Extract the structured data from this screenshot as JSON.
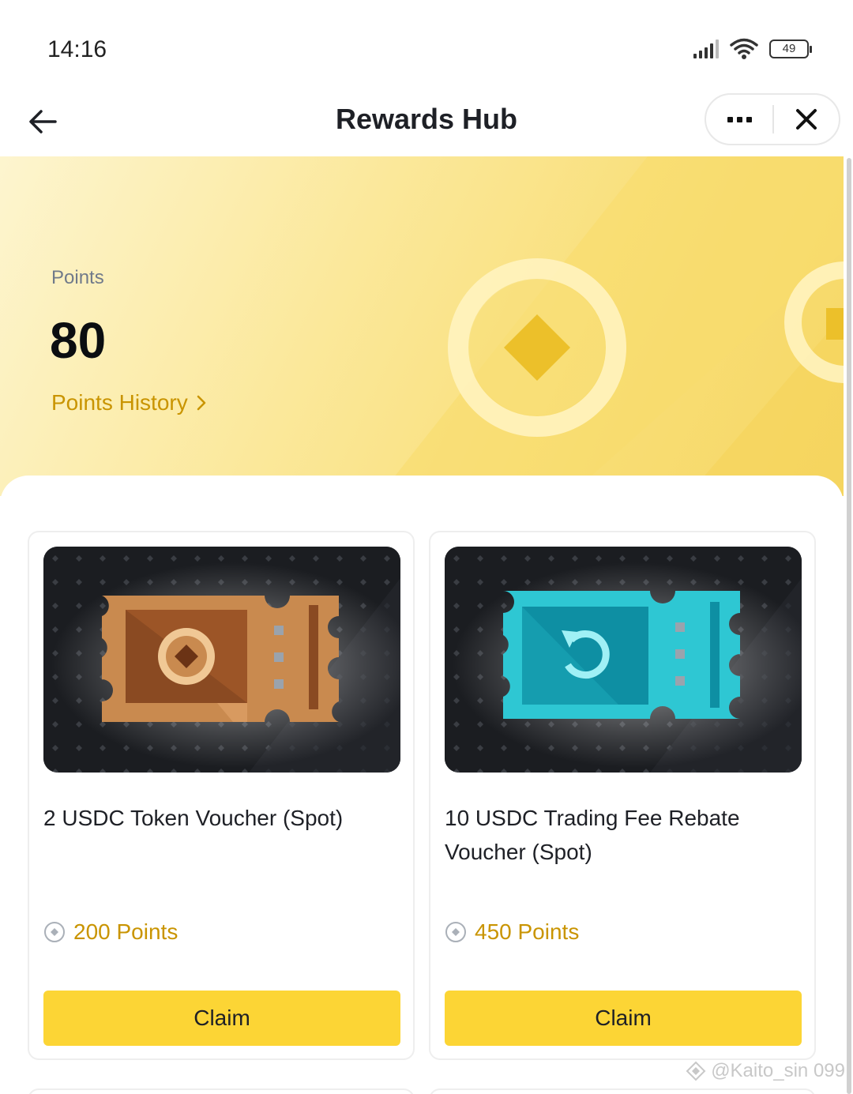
{
  "status_bar": {
    "time": "14:16",
    "battery": "49",
    "icons": [
      "signal-icon",
      "wifi-icon",
      "battery-icon"
    ]
  },
  "header": {
    "title": "Rewards Hub",
    "back_icon": "arrow-left-icon",
    "more_icon": "more-dots-icon",
    "close_icon": "close-icon"
  },
  "banner": {
    "points_label": "Points",
    "points_value": "80",
    "history_label": "Points History",
    "history_icon": "chevron-right-icon"
  },
  "rewards": [
    {
      "title": "2 USDC Token Voucher (Spot)",
      "points": "200 Points",
      "claim_label": "Claim",
      "ticket_color": "#c98a4f",
      "ticket_icon": "token-coin-icon"
    },
    {
      "title": "10 USDC Trading Fee Rebate Voucher (Spot)",
      "points": "450 Points",
      "claim_label": "Claim",
      "ticket_color": "#2ec7d3",
      "ticket_icon": "rebate-arrow-icon"
    }
  ],
  "watermark": "@Kaito_sin 099",
  "colors": {
    "accent_yellow": "#fcd535",
    "gold_text": "#c99400",
    "banner_start": "#fdf5cf",
    "banner_end": "#f6d766"
  }
}
